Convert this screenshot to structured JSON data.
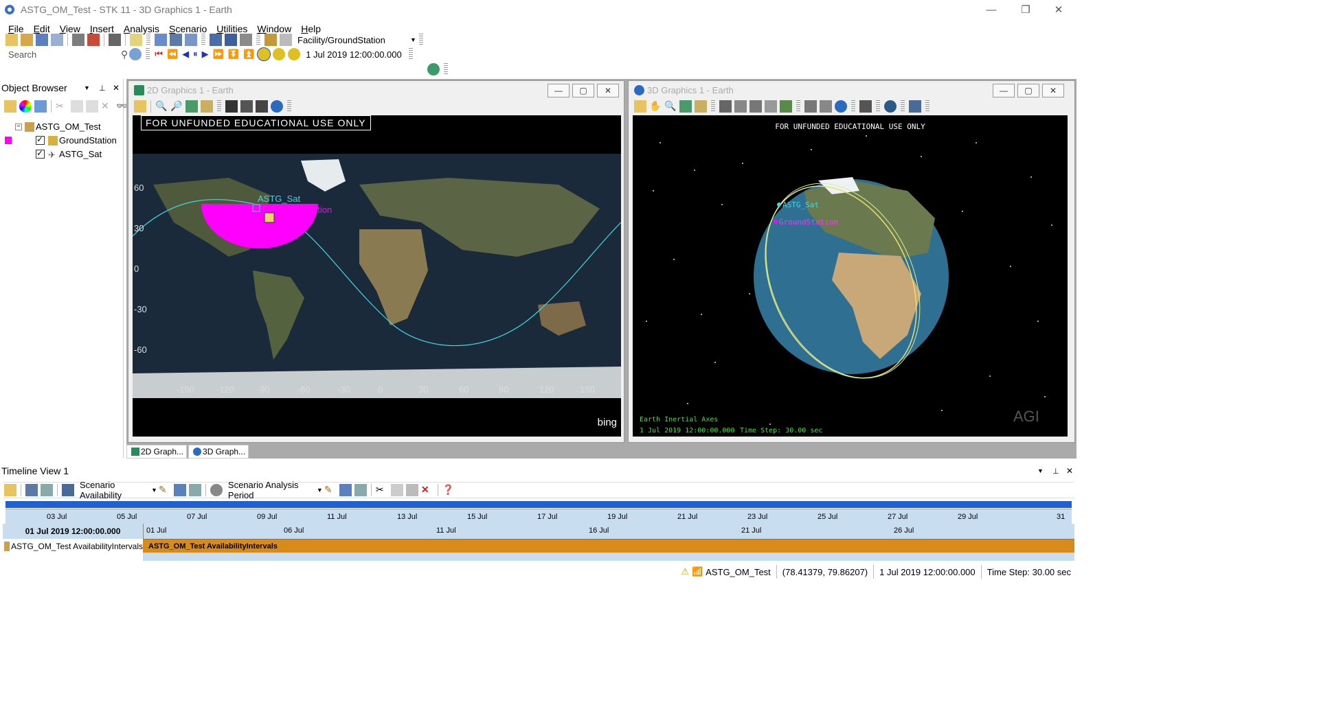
{
  "window": {
    "title": "ASTG_OM_Test - STK 11 - 3D Graphics 1 - Earth",
    "minimize": "—",
    "restore": "❐",
    "close": "✕"
  },
  "menu": [
    "File",
    "Edit",
    "View",
    "Insert",
    "Analysis",
    "Scenario",
    "Utilities",
    "Window",
    "Help"
  ],
  "toolbar": {
    "object_select": "Facility/GroundStation",
    "search_placeholder": "Search",
    "current_time": "1 Jul 2019 12:00:00.000"
  },
  "object_browser": {
    "title": "Object Browser",
    "scenario": "ASTG_OM_Test",
    "items": [
      "GroundStation",
      "ASTG_Sat"
    ],
    "groundstation_color": "#ff00ff"
  },
  "graphics2d": {
    "title": "2D Graphics 1 - Earth",
    "banner": "FOR UNFUNDED EDUCATIONAL USE ONLY",
    "sat_label": "ASTG_Sat",
    "station_label": "ation",
    "lat_ticks": [
      "60",
      "30",
      "0",
      "-30",
      "-60"
    ],
    "lon_ticks": [
      "-150",
      "-120",
      "-90",
      "-60",
      "-30",
      "0",
      "30",
      "60",
      "90",
      "120",
      "150"
    ],
    "provider": "bing"
  },
  "graphics3d": {
    "title": "3D Graphics 1 - Earth",
    "banner": "FOR UNFUNDED EDUCATIONAL USE ONLY",
    "sat_label": "ASTG_Sat",
    "station_label": "GroundStation",
    "axes": "Earth Inertial Axes",
    "time": "1 Jul 2019 12:00:00.000",
    "timestep": "Time Step: 30.00 sec",
    "logo": "AGI"
  },
  "mdi_tabs": [
    "2D Graph...",
    "3D Graph..."
  ],
  "timeline": {
    "title": "Timeline View 1",
    "availability_select": "Scenario Availability",
    "period_select": "Scenario Analysis Period",
    "overview_ticks": [
      "03 Jul",
      "05 Jul",
      "07 Jul",
      "09 Jul",
      "11 Jul",
      "13 Jul",
      "15 Jul",
      "17 Jul",
      "19 Jul",
      "21 Jul",
      "23 Jul",
      "25 Jul",
      "27 Jul",
      "29 Jul",
      "31"
    ],
    "current_time": "01 Jul 2019 12:00:00.000",
    "detail_ticks": [
      "01 Jul",
      "06 Jul",
      "11 Jul",
      "16 Jul",
      "21 Jul",
      "26 Jul"
    ],
    "row_label": "ASTG_OM_Test AvailabilityIntervals",
    "bar_label": "ASTG_OM_Test AvailabilityIntervals"
  },
  "status": {
    "scenario": "ASTG_OM_Test",
    "coords": "(78.41379, 79.86207)",
    "time": "1 Jul 2019 12:00:00.000",
    "timestep": "Time Step: 30.00 sec"
  }
}
